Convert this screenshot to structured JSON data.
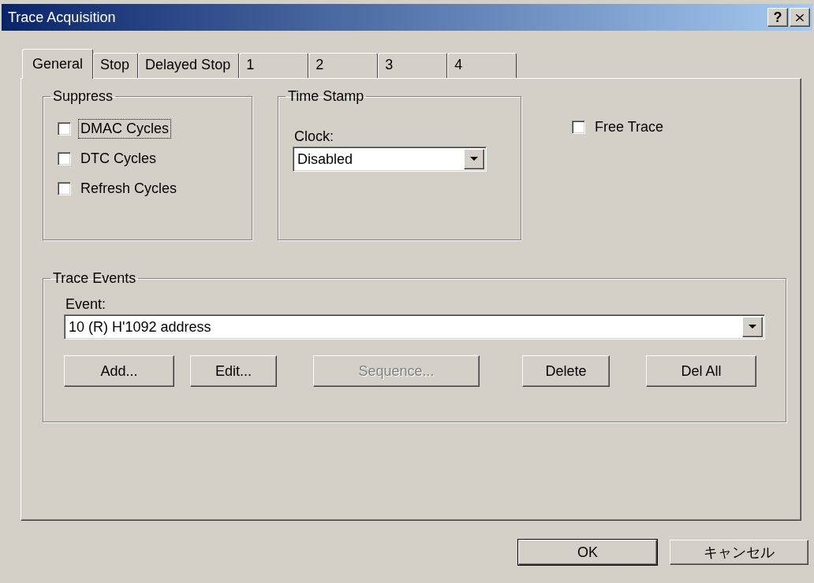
{
  "window": {
    "title": "Trace Acquisition",
    "help_button": "?"
  },
  "tabs": [
    {
      "label": "General",
      "selected": true
    },
    {
      "label": "Stop",
      "selected": false
    },
    {
      "label": "Delayed Stop",
      "selected": false
    },
    {
      "label": "1",
      "selected": false
    },
    {
      "label": "2",
      "selected": false
    },
    {
      "label": "3",
      "selected": false
    },
    {
      "label": "4",
      "selected": false
    }
  ],
  "suppress": {
    "title": "Suppress",
    "options": [
      {
        "label": "DMAC Cycles",
        "checked": false,
        "focused": true
      },
      {
        "label": "DTC Cycles",
        "checked": false,
        "focused": false
      },
      {
        "label": "Refresh Cycles",
        "checked": false,
        "focused": false
      }
    ]
  },
  "time_stamp": {
    "title": "Time Stamp",
    "clock": {
      "label": "Clock:",
      "value": "Disabled"
    }
  },
  "free_trace": {
    "label": "Free Trace",
    "checked": false,
    "focused": false
  },
  "trace_events": {
    "title": "Trace Events",
    "event": {
      "label": "Event:",
      "value": "10 (R) H'1092 address"
    },
    "buttons": [
      {
        "label": "Add...",
        "disabled": false
      },
      {
        "label": "Edit...",
        "disabled": false
      },
      {
        "label": "Sequence...",
        "disabled": true
      },
      {
        "label": "Delete",
        "disabled": false
      },
      {
        "label": "Del All",
        "disabled": false
      }
    ]
  },
  "dialog_buttons": [
    {
      "label": "OK",
      "default": true
    },
    {
      "label": "キャンセル",
      "default": false
    }
  ]
}
